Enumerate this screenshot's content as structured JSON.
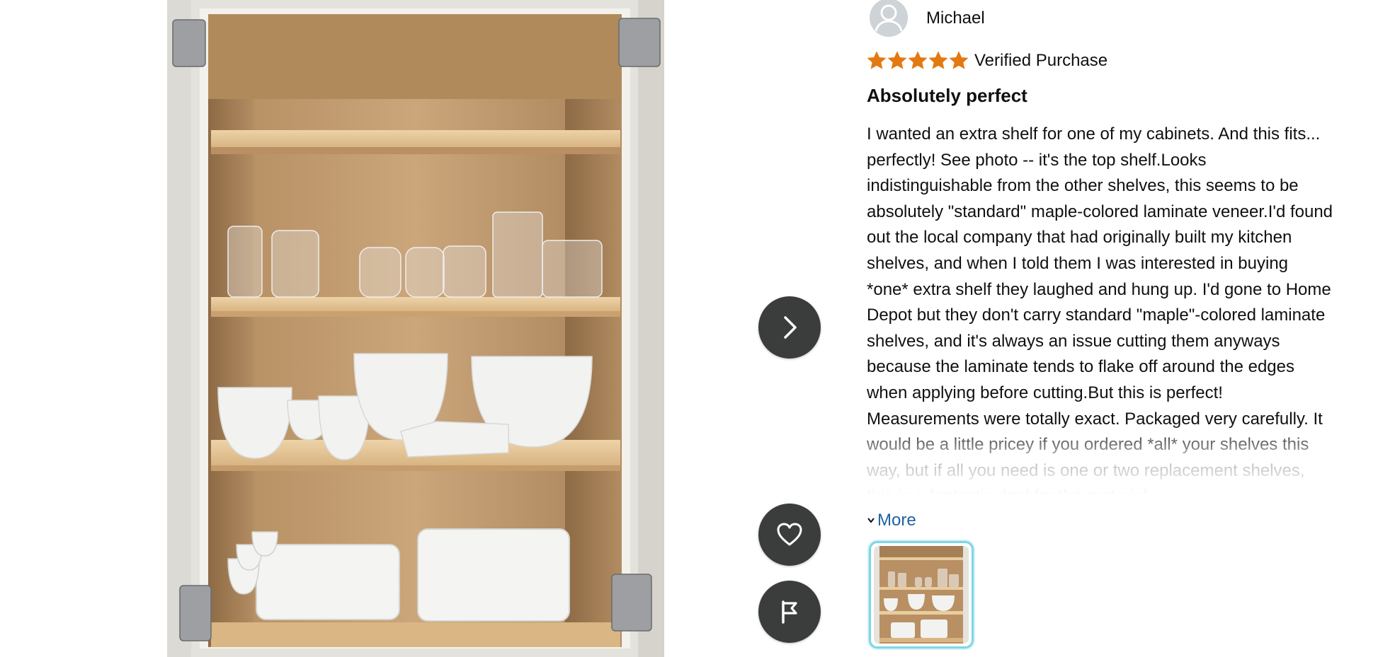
{
  "reviewer": {
    "name": "Michael",
    "avatar_icon": "person-avatar-icon"
  },
  "rating": {
    "stars": 5,
    "max": 5,
    "star_color": "#e47911",
    "badge": "Verified Purchase"
  },
  "review": {
    "title": "Absolutely perfect",
    "body": "I wanted an extra shelf for one of my cabinets. And this fits... perfectly! See photo -- it's the top shelf.Looks indistinguishable from the other shelves, this seems to be absolutely \"standard\" maple-colored laminate veneer.I'd found out the local company that had originally built my kitchen shelves, and when I told them I was interested in buying *one* extra shelf they laughed and hung up. I'd gone to Home Depot but they don't carry standard \"maple\"-colored laminate shelves, and it's always an issue cutting them anyways because the laminate tends to flake off around the edges when applying before cutting.But this is perfect! Measurements were totally exact. Packaged very carefully. It would be a little pricey if you ordered *all* your shelves this way, but if all you need is one or two replacement shelves, this is a fantastic deal for the material",
    "more_label": "More"
  },
  "controls": {
    "next_icon": "chevron-right-icon",
    "like_icon": "heart-icon",
    "report_icon": "flag-icon"
  },
  "colors": {
    "link": "#2162a1",
    "button_bg": "#3b3d3d",
    "thumb_border": "#7fd6e6"
  }
}
